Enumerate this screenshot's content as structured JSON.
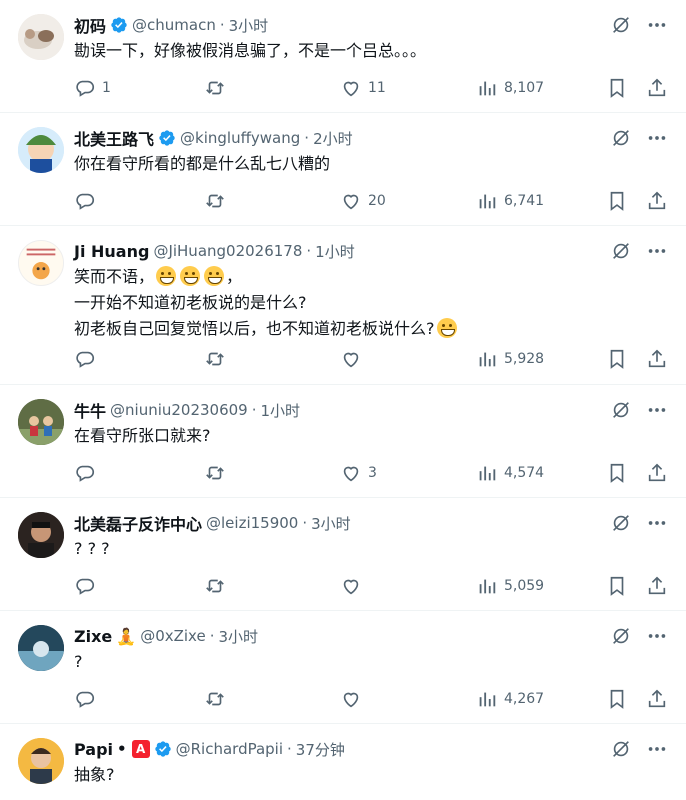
{
  "tweets": [
    {
      "name": "初码",
      "verified": true,
      "handle": "@chumacn",
      "time": "3小时",
      "lines": [
        "勘误一下，好像被假消息骗了，不是一个吕总。。。"
      ],
      "reply_count": "1",
      "retweet_count": "",
      "like_count": "11",
      "view_count": "8,107"
    },
    {
      "name": "北美王路飞",
      "verified": true,
      "handle": "@kingluffywang",
      "time": "2小时",
      "lines": [
        "你在看守所看的都是什么乱七八糟的"
      ],
      "reply_count": "",
      "retweet_count": "",
      "like_count": "20",
      "view_count": "6,741"
    },
    {
      "name": "Ji Huang",
      "verified": false,
      "handle": "@JiHuang02026178",
      "time": "1小时",
      "lines_a": "笑而不语，",
      "lines_b": "，",
      "lines": [
        "一开始不知道初老板说的是什么?",
        "初老板自己回复觉悟以后，也不知道初老板说什么?"
      ],
      "reply_count": "",
      "retweet_count": "",
      "like_count": "",
      "view_count": "5,928"
    },
    {
      "name": "牛牛",
      "verified": false,
      "handle": "@niuniu20230609",
      "time": "1小时",
      "lines": [
        "在看守所张口就来?"
      ],
      "reply_count": "",
      "retweet_count": "",
      "like_count": "3",
      "view_count": "4,574"
    },
    {
      "name": "北美磊子反诈中心",
      "verified": false,
      "handle": "@leizi15900",
      "time": "3小时",
      "lines": [
        "? ? ?"
      ],
      "reply_count": "",
      "retweet_count": "",
      "like_count": "",
      "view_count": "5,059"
    },
    {
      "name": "Zixe",
      "verified": false,
      "handle": "@0xZixe",
      "time": "3小时",
      "lines": [
        "?"
      ],
      "reply_count": "",
      "retweet_count": "",
      "like_count": "",
      "view_count": "4,267"
    },
    {
      "name": "Papi",
      "verified": true,
      "handle": "@RichardPapii",
      "time": "37分钟",
      "badge": "A",
      "lines": [
        "抽象?"
      ],
      "reply_count": "",
      "retweet_count": "",
      "like_count": "",
      "view_count": ""
    }
  ],
  "misc": {
    "separator_dot": "·",
    "name_dot": "•"
  },
  "colors": {
    "verified": "#1d9bf0",
    "muted": "#536471",
    "text": "#0f1419"
  },
  "icons": [
    "reply-icon",
    "retweet-icon",
    "like-icon",
    "views-icon",
    "bookmark-icon",
    "share-icon",
    "grok-icon",
    "more-icon",
    "verified-icon"
  ]
}
